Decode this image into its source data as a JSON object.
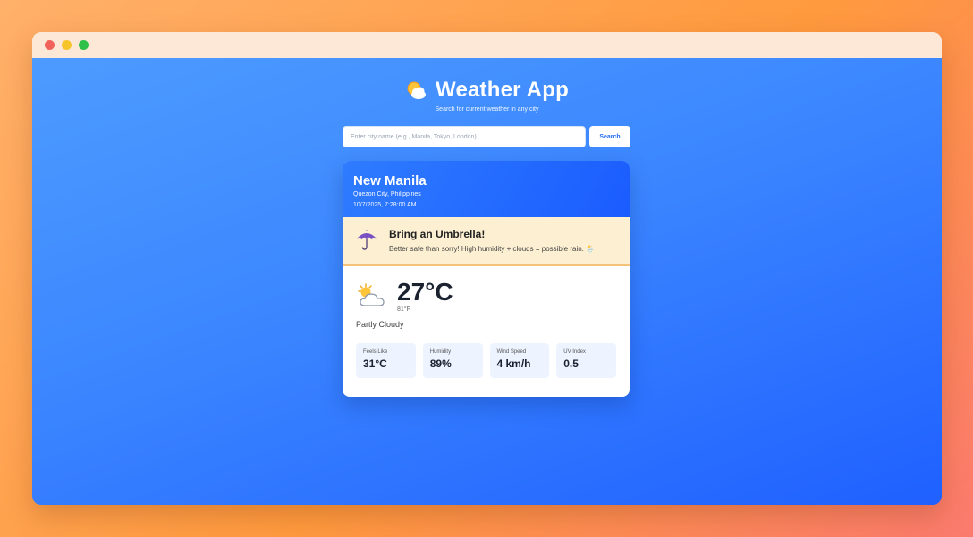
{
  "window": {
    "controls": [
      "close",
      "minimize",
      "maximize"
    ]
  },
  "header": {
    "icon": "sun-behind-cloud-icon",
    "title": "Weather App",
    "subtitle": "Search for current weather in any city"
  },
  "search": {
    "placeholder": "Enter city name (e.g., Manila, Tokyo, London)",
    "value": "",
    "button_label": "Search"
  },
  "weather": {
    "city": "New Manila",
    "region": "Quezon City, Philippines",
    "timestamp": "10/7/2025, 7:28:00 AM",
    "advice": {
      "icon": "umbrella-icon",
      "title": "Bring an Umbrella!",
      "text": "Better safe than sorry! High humidity + clouds = possible rain. 🌦️"
    },
    "icon": "partly-cloudy-icon",
    "temp_c": "27°C",
    "temp_f": "81°F",
    "condition": "Partly Cloudy",
    "stats": [
      {
        "label": "Feels Like",
        "value": "31°C"
      },
      {
        "label": "Humidity",
        "value": "89%"
      },
      {
        "label": "Wind Speed",
        "value": "4 km/h"
      },
      {
        "label": "UV Index",
        "value": "0.5"
      }
    ]
  },
  "colors": {
    "page_gradient_start": "#ffb06a",
    "page_gradient_end": "#fb7a6e",
    "viewport_blue": "#3b86ff",
    "accent": "#1f6af0",
    "advice_bg": "#fdf0d2"
  }
}
